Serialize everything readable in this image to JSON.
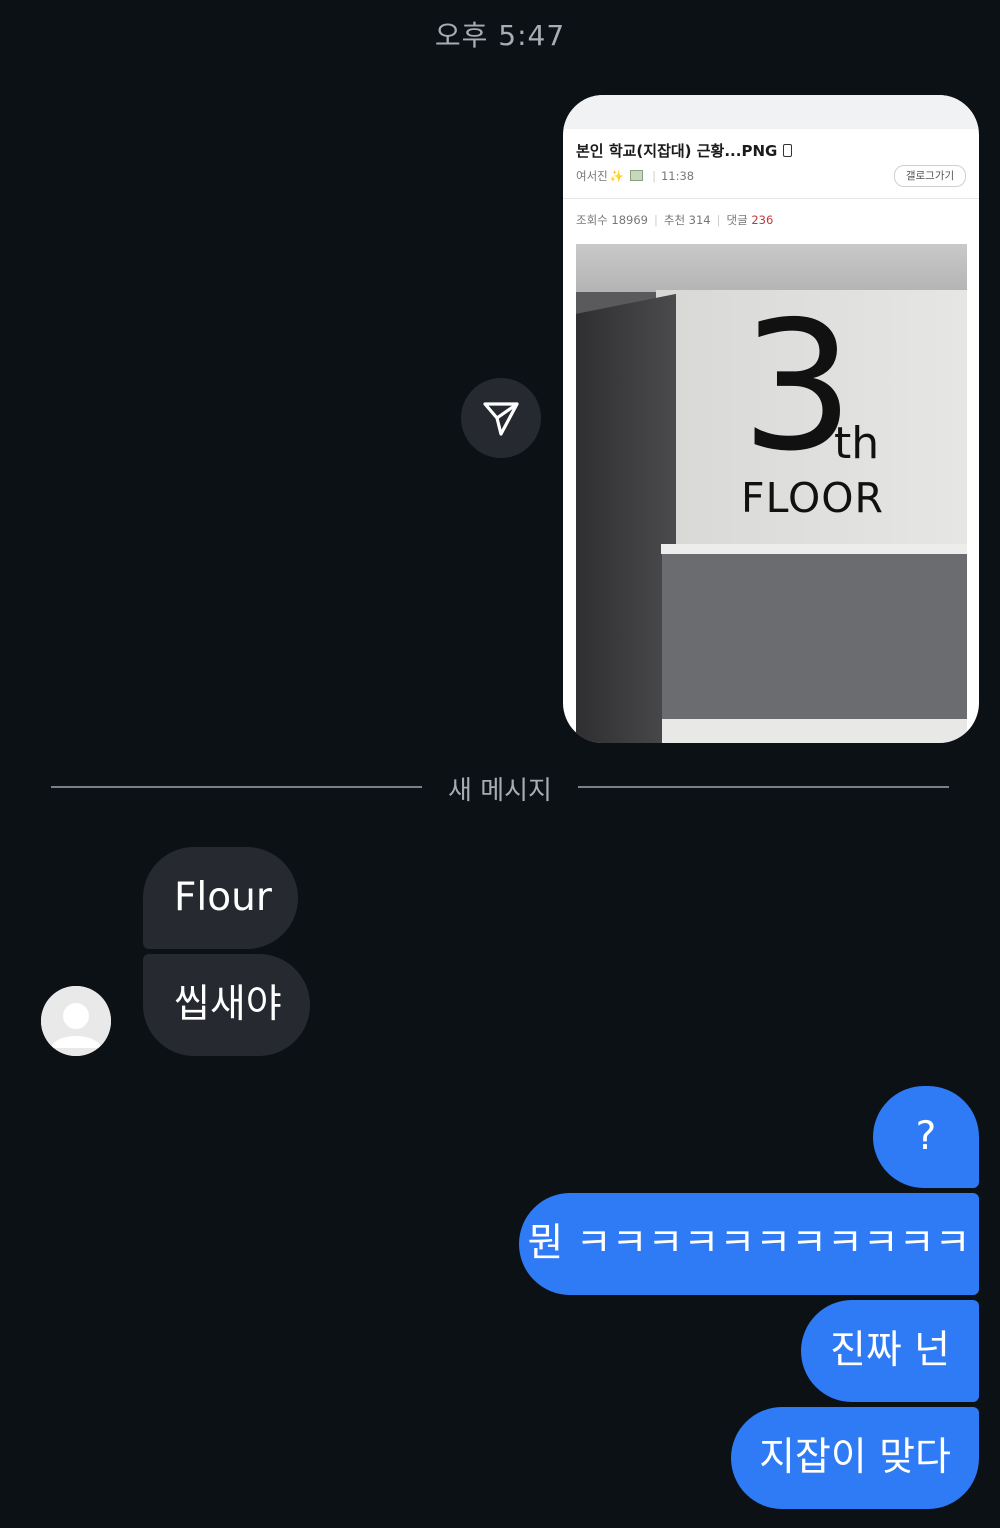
{
  "timestamp": "오후 5:47",
  "shared_post": {
    "title": "본인 학교(지잡대) 근황...PNG",
    "author": "여서진",
    "time": "11:38",
    "gallery_button": "갤로그가기",
    "views": "조회수 18969",
    "recommends": "추천 314",
    "comments_label": "댓글",
    "comments_count": "236",
    "sign_number": "3",
    "sign_suffix": "th",
    "sign_floor": "FLOOR"
  },
  "divider": {
    "label": "새 메시지"
  },
  "received_messages": [
    {
      "text": "Flour"
    },
    {
      "text": "씹새야"
    }
  ],
  "sent_messages": [
    {
      "text": "?"
    },
    {
      "text": "뭔 ㅋㅋㅋㅋㅋㅋㅋㅋㅋㅋㅋ"
    },
    {
      "text": "진짜 넌"
    },
    {
      "text": "지잡이 맞다"
    }
  ],
  "colors": {
    "background": "#0c1116",
    "received_bubble": "#262a30",
    "sent_bubble": "#2f7bf5",
    "text_primary": "#ffffff",
    "text_muted": "#a7adb4"
  },
  "icons": {
    "share": "paper-plane-icon",
    "avatar": "default-user-avatar"
  }
}
